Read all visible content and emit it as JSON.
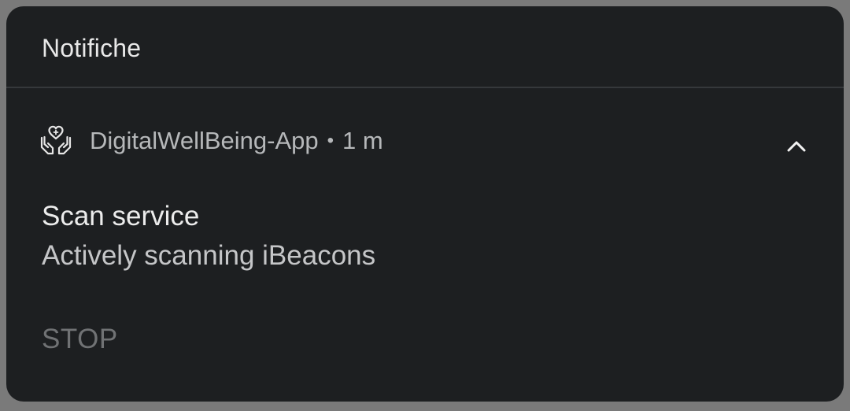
{
  "panel": {
    "title": "Notifiche"
  },
  "notification": {
    "app_icon": "heart-in-hands-icon",
    "app_name": "DigitalWellBeing-App",
    "separator": "•",
    "time": "1 m",
    "expand_icon": "chevron-up-icon",
    "title": "Scan service",
    "text": "Actively scanning iBeacons",
    "actions": [
      {
        "label": "STOP"
      }
    ]
  },
  "colors": {
    "panel_background": "#1d1f21",
    "screen_background": "#7a7a7a",
    "primary_text": "#ececec",
    "secondary_text": "#b6b8ba",
    "action_text": "#707274",
    "divider": "#35383b"
  }
}
